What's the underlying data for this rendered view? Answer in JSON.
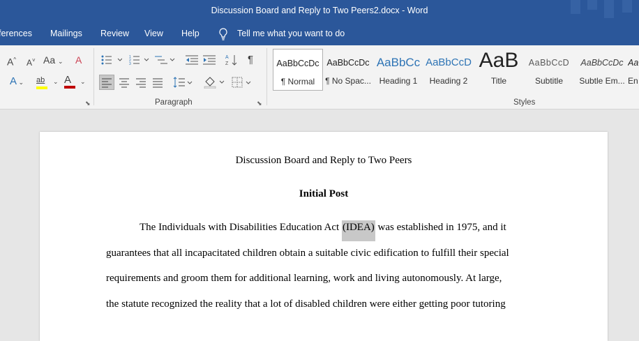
{
  "window": {
    "title": "Discussion Board and Reply to Two Peers2.docx  -  Word"
  },
  "menu": {
    "items": [
      "ferences",
      "Mailings",
      "Review",
      "View",
      "Help"
    ],
    "tell_me": "Tell me what you want to do"
  },
  "ribbon": {
    "font_group": {
      "grow_font": "A",
      "shrink_font": "A",
      "change_case": "Aa",
      "clear_formatting": "A",
      "text_effects": "A",
      "highlight": "ab",
      "font_color": "A"
    },
    "paragraph_group": {
      "label": "Paragraph"
    },
    "styles_group": {
      "label": "Styles",
      "tiles": [
        {
          "sample": "AaBbCcDc",
          "name": "¶ Normal",
          "selected": true
        },
        {
          "sample": "AaBbCcDc",
          "name": "¶ No Spac..."
        },
        {
          "sample": "AaBbCc",
          "name": "Heading 1"
        },
        {
          "sample": "AaBbCcD",
          "name": "Heading 2"
        },
        {
          "sample": "AaB",
          "name": "Title"
        },
        {
          "sample": "AaBbCcD",
          "name": "Subtitle"
        },
        {
          "sample": "AaBbCcDc",
          "name": "Subtle Em..."
        },
        {
          "sample": "Aa",
          "name": "En"
        }
      ]
    }
  },
  "document": {
    "heading": "Discussion Board and Reply to Two Peers",
    "subheading": "Initial Post",
    "paragraph": {
      "line1_before": "The Individuals with Disabilities Education Act ",
      "line1_highlight": "(IDEA)",
      "line1_after": " was established in 1975, and it",
      "line2": "guarantees that all incapacitated children obtain a suitable civic edification to fulfill their special",
      "line3": "requirements and groom them for additional learning, work and living autonomously. At large,",
      "line4": "the statute recognized the reality that a lot of disabled children were either getting poor tutoring"
    }
  },
  "colors": {
    "word_blue": "#2b579a",
    "ribbon_bg": "#f3f3f3",
    "doc_bg": "#e6e6e6",
    "heading1_blue": "#2e74b5",
    "font_red": "#c00000",
    "highlight_yellow": "#ffff00"
  }
}
